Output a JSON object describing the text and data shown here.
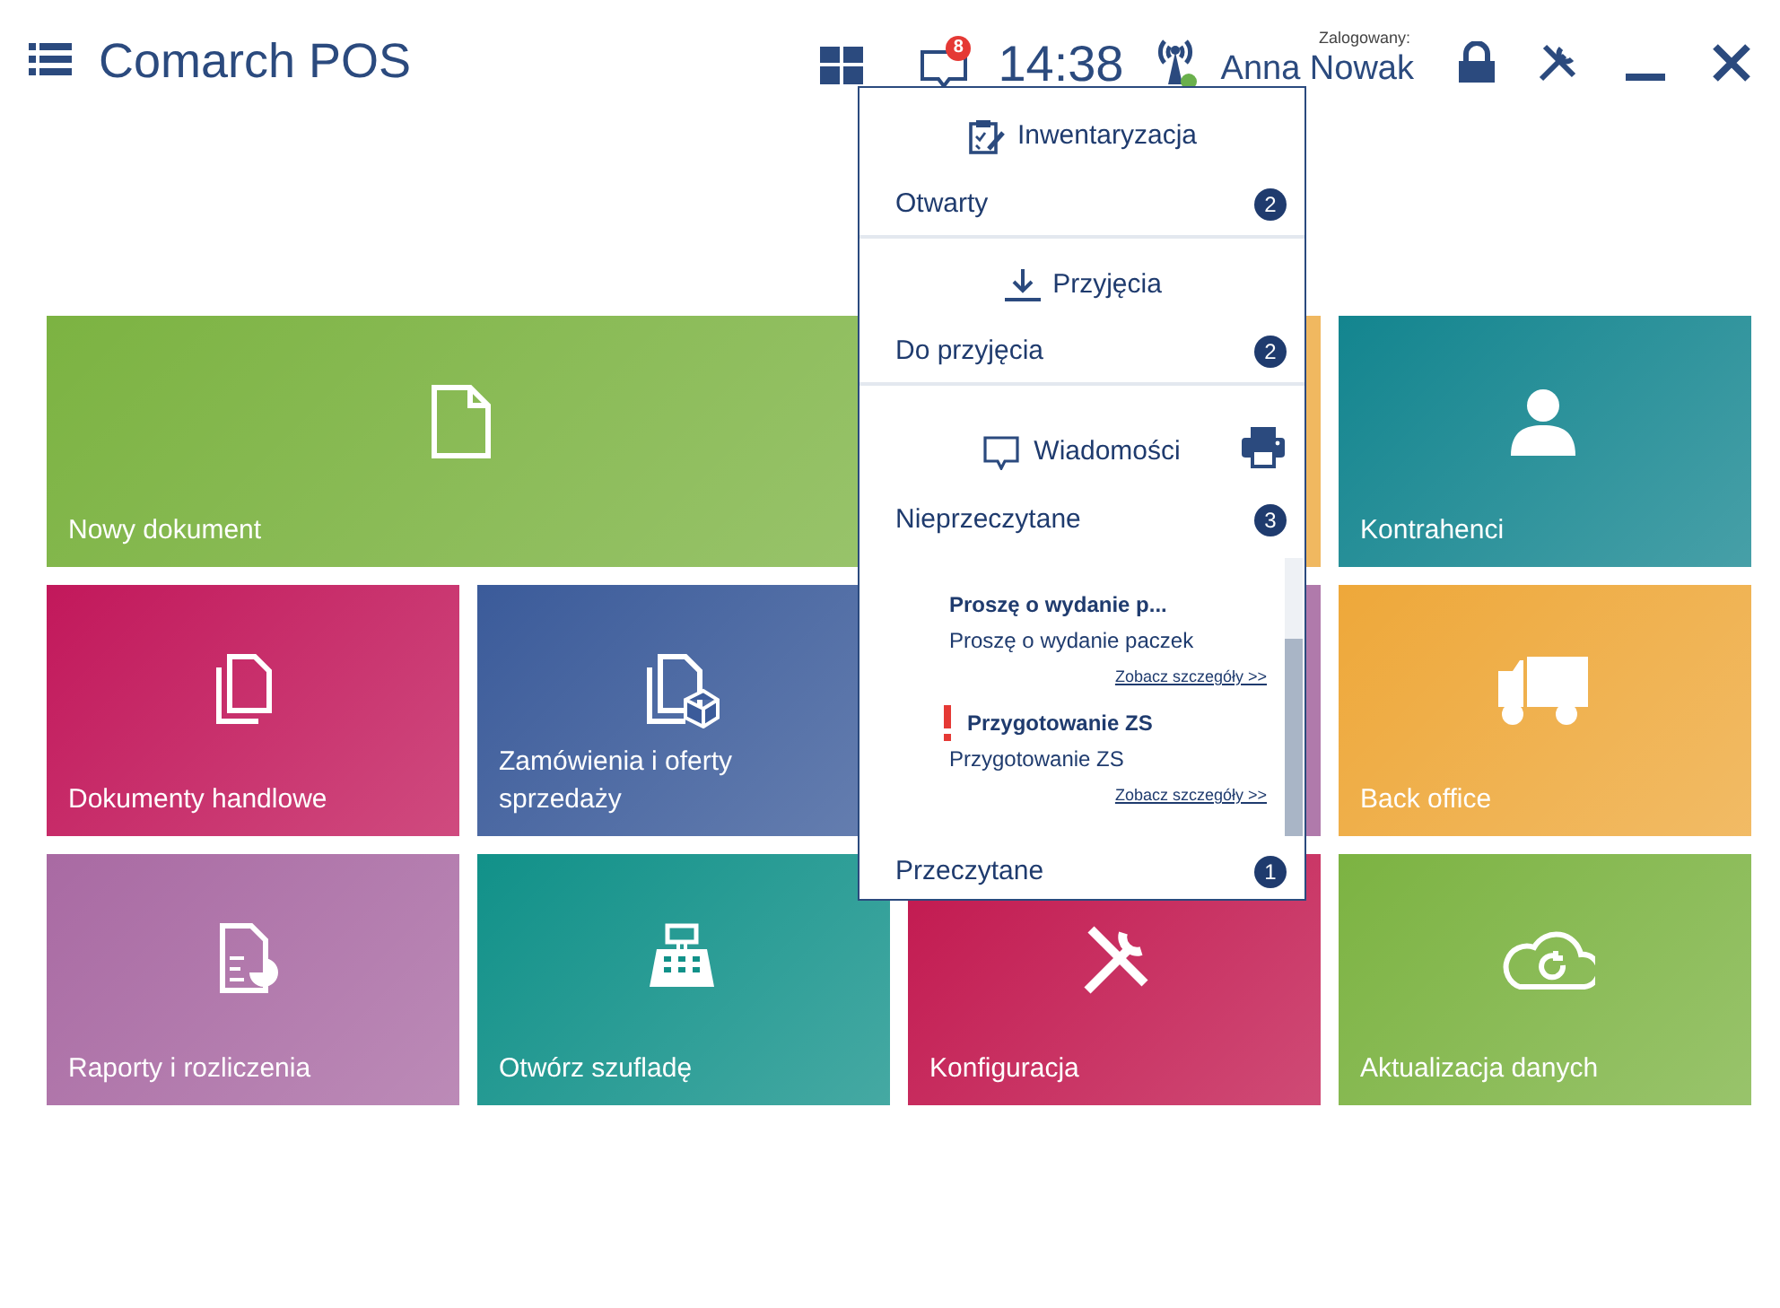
{
  "header": {
    "title": "Comarch POS",
    "notification_count": "8",
    "time": "14:38",
    "connected": true,
    "login_label": "Zalogowany:",
    "user": "Anna Nowak"
  },
  "tiles": [
    {
      "kind": "document",
      "label": "Nowy dokument",
      "color": "#7cb342",
      "wide": true
    },
    {
      "kind": "blank",
      "color": "#f0b860",
      "wide": false
    },
    {
      "kind": "person",
      "label": "Kontrahenci",
      "color": "#13858f",
      "wide": false
    },
    {
      "kind": "documents",
      "label": "Dokumenty handlowe",
      "color": "#c2185b",
      "wide": false
    },
    {
      "kind": "orders",
      "label": "Zamówienia i oferty sprzedaży",
      "color": "#3b5b9a",
      "wide": false
    },
    {
      "kind": "blank",
      "color": "#b07aab",
      "wide": false
    },
    {
      "kind": "truck",
      "label": "Back office",
      "color": "#eea83a",
      "wide": false
    },
    {
      "kind": "report",
      "label": "Raporty i rozliczenia",
      "color": "#a96aa3",
      "wide": false
    },
    {
      "kind": "register",
      "label": "Otwórz szufladę",
      "color": "#119189",
      "wide": false
    },
    {
      "kind": "tools",
      "label": "Konfiguracja",
      "color": "#c2184f",
      "wide": false
    },
    {
      "kind": "cloud",
      "label": "Aktualizacja danych",
      "color": "#7cb342",
      "wide": false
    }
  ],
  "dropdown": {
    "sections": [
      {
        "kind": "inventory",
        "title": "Inwentaryzacja",
        "rows": [
          {
            "label": "Otwarty",
            "count": "2"
          }
        ]
      },
      {
        "kind": "receipt",
        "title": "Przyjęcia",
        "rows": [
          {
            "label": "Do przyjęcia",
            "count": "2"
          }
        ]
      },
      {
        "kind": "messages",
        "title": "Wiadomości",
        "printer": true,
        "rows": [
          {
            "label": "Nieprzeczytane",
            "count": "3"
          }
        ],
        "messages": [
          {
            "title": "Proszę o wydanie p...",
            "body": "Proszę o wydanie paczek",
            "link": "Zobacz szczegóły >>",
            "urgent": false
          },
          {
            "title": "Przygotowanie ZS",
            "body": "Przygotowanie ZS",
            "link": "Zobacz szczegóły >>",
            "urgent": true
          }
        ],
        "footer_rows": [
          {
            "label": "Przeczytane",
            "count": "1"
          }
        ]
      }
    ]
  }
}
